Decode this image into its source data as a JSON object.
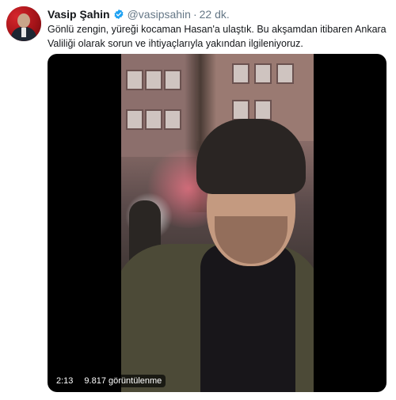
{
  "tweet": {
    "author_name": "Vasip Şahin",
    "handle": "@vasipsahin",
    "separator": "·",
    "time": "22 dk.",
    "text_lines": [
      "Gönlü zengin, yüreği kocaman Hasan'a ulaştık. Bu akşamdan itibaren Ankara",
      "Valiliği olarak sorun ve ihtiyaçlarıyla yakından ilgileniyoruz."
    ]
  },
  "video": {
    "duration": "2:13",
    "views": "9.817 görüntülenme"
  },
  "icons": {
    "verified": "verified-badge-icon"
  },
  "colors": {
    "verified": "#1da1f2",
    "secondary_text": "#657786",
    "primary_text": "#14171a"
  }
}
